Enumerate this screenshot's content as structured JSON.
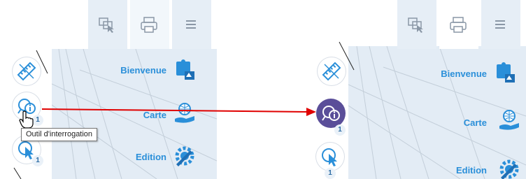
{
  "left": {
    "menu": [
      {
        "label": "Bienvenue",
        "icon": "puzzle-icon"
      },
      {
        "label": "Carte",
        "icon": "globe-hand-icon"
      },
      {
        "label": "Edition",
        "icon": "pencil-gear-icon"
      }
    ],
    "tools": [
      {
        "icon": "measure-icon",
        "count": ""
      },
      {
        "icon": "info-query-icon",
        "count": "1"
      },
      {
        "icon": "select-cursor-icon",
        "count": "1"
      }
    ],
    "tooltip": "Outil d'interrogation"
  },
  "right": {
    "menu": [
      {
        "label": "Bienvenue",
        "icon": "puzzle-icon"
      },
      {
        "label": "Carte",
        "icon": "globe-hand-icon"
      },
      {
        "label": "Edition",
        "icon": "pencil-gear-icon"
      }
    ],
    "tools": [
      {
        "icon": "measure-icon",
        "count": ""
      },
      {
        "icon": "info-query-icon",
        "count": "1",
        "active": true
      },
      {
        "icon": "select-cursor-icon",
        "count": "1"
      }
    ]
  },
  "toolbar": [
    "selection-window-icon",
    "print-icon",
    "menu-lines-icon"
  ],
  "colors": {
    "accent": "#2a8fd9",
    "active_tool": "#5a4e99",
    "arrow": "#e00000",
    "map": "#e3ecf5"
  }
}
